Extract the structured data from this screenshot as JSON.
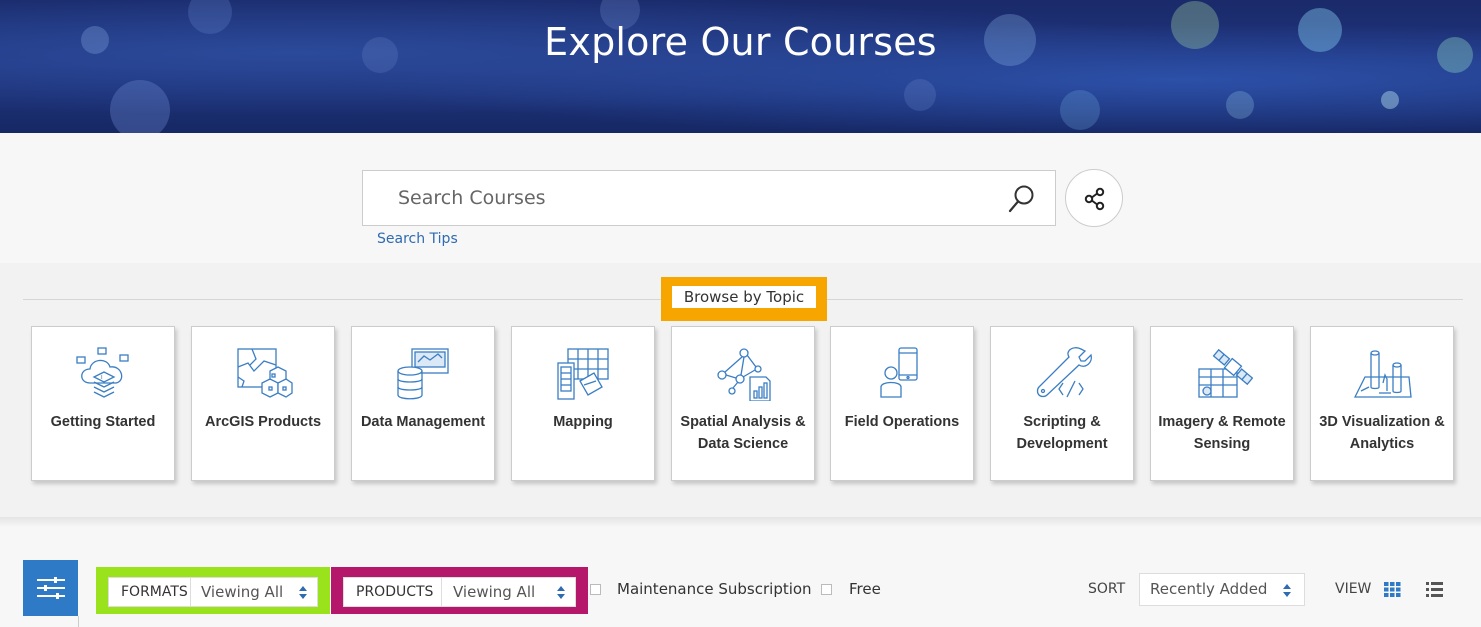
{
  "hero": {
    "title": "Explore Our Courses"
  },
  "search": {
    "placeholder": "Search Courses",
    "tips_label": "Search Tips"
  },
  "browse": {
    "heading": "Browse by Topic",
    "highlight_color": "#f7a600",
    "topics": [
      {
        "label": "Getting Started",
        "icon": "cloud-layers-icon"
      },
      {
        "label": "ArcGIS Products",
        "icon": "map-hexagon-icon"
      },
      {
        "label": "Data Management",
        "icon": "database-icon"
      },
      {
        "label": "Mapping",
        "icon": "map-grid-icon"
      },
      {
        "label": "Spatial Analysis & Data Science",
        "icon": "network-chart-icon"
      },
      {
        "label": "Field Operations",
        "icon": "mobile-user-icon"
      },
      {
        "label": "Scripting & Development",
        "icon": "wrench-code-icon"
      },
      {
        "label": "Imagery & Remote Sensing",
        "icon": "satellite-icon"
      },
      {
        "label": "3D Visualization & Analytics",
        "icon": "cylinders-icon"
      }
    ]
  },
  "filters": {
    "formats": {
      "label": "FORMATS",
      "value": "Viewing All",
      "highlight_color": "#9ae21b"
    },
    "products": {
      "label": "PRODUCTS",
      "value": "Viewing All",
      "highlight_color": "#b5176a"
    },
    "maintenance_label": "Maintenance Subscription",
    "free_label": "Free",
    "sort_label": "SORT",
    "sort_value": "Recently Added",
    "view_label": "VIEW"
  },
  "colors": {
    "accent": "#2e7ac6",
    "link": "#2e6bb1",
    "icon_stroke": "#3b7ec3"
  }
}
